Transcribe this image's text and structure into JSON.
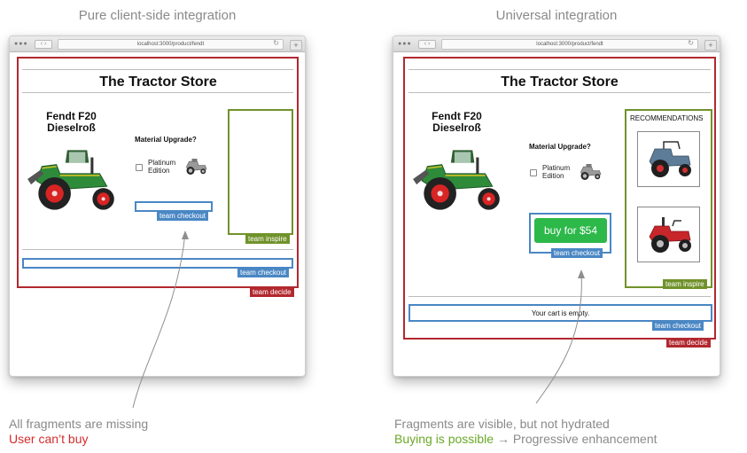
{
  "left_panel": {
    "heading": "Pure client-side integration",
    "browser": {
      "url": "localhost:3000/product/fendt"
    },
    "store_title": "The Tractor Store",
    "product_name": "Fendt F20\nDieselroß",
    "upgrade_question": "Material Upgrade?",
    "option_label": "Platinum\nEdition",
    "tags": {
      "buy_checkout": "team checkout",
      "inspire": "team inspire",
      "minicart_checkout": "team checkout",
      "decide": "team decide"
    },
    "caption_line1": "All fragments are missing",
    "caption_line2": "User can’t buy"
  },
  "right_panel": {
    "heading": "Universal integration",
    "browser": {
      "url": "localhost:3000/product/fendt"
    },
    "store_title": "The Tractor Store",
    "product_name": "Fendt F20\nDieselroß",
    "upgrade_question": "Material Upgrade?",
    "option_label": "Platinum\nEdition",
    "recommendations_title": "RECOMMENDATIONS",
    "buy_button": "buy for $54",
    "cart_text": "Your cart is empty.",
    "tags": {
      "buy_checkout": "team checkout",
      "inspire": "team inspire",
      "minicart_checkout": "team checkout",
      "decide": "team decide"
    },
    "caption_line1": "Fragments are visible, but not hydrated",
    "caption_line2_green": "Buying is possible",
    "caption_line2_arrow": "→",
    "caption_line2_rest": "Progressive enhancement"
  },
  "colors": {
    "decide": "#b2282f",
    "inspire": "#70922b",
    "checkout": "#4a87c4",
    "buy_button": "#2db84a",
    "caption_red": "#d42c2c",
    "caption_green": "#6aa827"
  },
  "icons": {
    "window_buttons": "●●●",
    "nav": "‹ ›",
    "reload": "↻",
    "new_tab": "+"
  }
}
